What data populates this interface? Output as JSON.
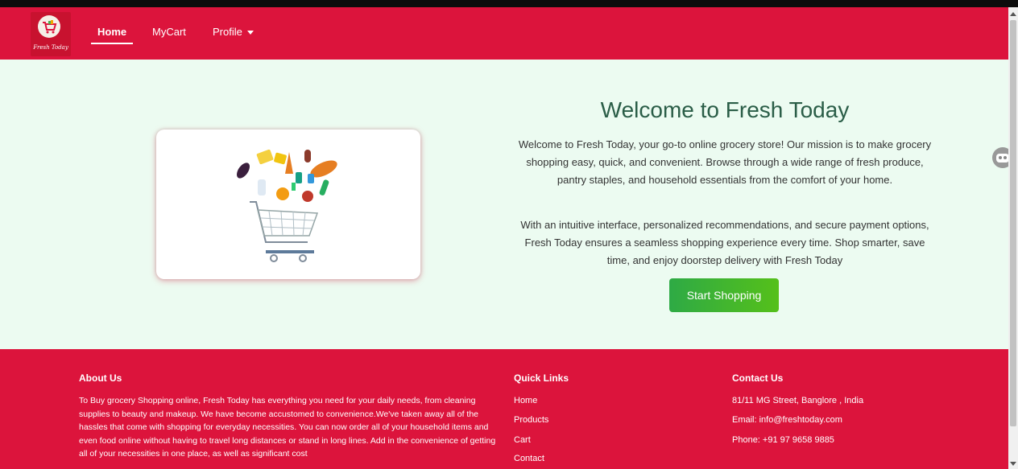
{
  "nav": {
    "logo_text": "Fresh Today",
    "home": "Home",
    "cart": "MyCart",
    "profile": "Profile"
  },
  "hero": {
    "title": "Welcome to Fresh Today",
    "paragraph1": "Welcome to Fresh Today, your go-to online grocery store! Our mission is to make grocery shopping easy, quick, and convenient. Browse through a wide range of fresh produce, pantry staples, and household essentials from the comfort of your home.",
    "paragraph2": "With an intuitive interface, personalized recommendations, and secure payment options, Fresh Today ensures a seamless shopping experience every time. Shop smarter, save time, and enjoy doorstep delivery with Fresh Today",
    "button": "Start Shopping"
  },
  "footer": {
    "about_heading": "About Us",
    "about_text": "To Buy grocery Shopping online, Fresh Today has everything you need for your daily needs, from cleaning supplies to beauty and makeup. We have become accustomed to convenience.We've taken away all of the hassles that come with shopping for everyday necessities. You can now order all of your household items and even food online without having to travel long distances or stand in long lines. Add in the convenience of getting all of your necessities in one place, as well as significant cost",
    "quick_heading": "Quick Links",
    "links": [
      "Home",
      "Products",
      "Cart",
      "Contact"
    ],
    "contact_heading": "Contact Us",
    "address": "81/11 MG Street, Banglore , India",
    "email": "Email: info@freshtoday.com",
    "phone": "Phone: +91 97 9658 9885"
  },
  "colors": {
    "brand_red": "#dc143c",
    "hero_bg": "#ecfbf1",
    "title_green": "#2a5d47",
    "button_green": "#3cb43a"
  }
}
